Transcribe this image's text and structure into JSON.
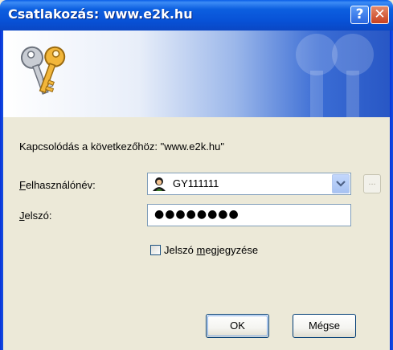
{
  "window": {
    "title": "Csatlakozás: www.e2k.hu",
    "help_label": "?",
    "close_label": "✕"
  },
  "dialog": {
    "connect_text": "Kapcsolódás a következőhöz: \"www.e2k.hu\"",
    "username_label_hotkey": "F",
    "username_label_rest": "elhasználónév:",
    "username_value": "GY111111",
    "password_label_hotkey": "J",
    "password_label_rest": "elszó:",
    "password_mask": "●●●●●●●●",
    "browse_label": "...",
    "remember_label_before": "Jelszó ",
    "remember_label_hotkey": "m",
    "remember_label_after": "egjegyzése",
    "remember_checked": false,
    "ok_label": "OK",
    "cancel_label": "Mégse"
  },
  "colors": {
    "title_bar": "#0851d6",
    "dialog_bg": "#ece9d8",
    "input_border": "#7f9db9"
  },
  "icons": {
    "banner": "keys-icon",
    "user": "user-icon",
    "dropdown": "chevron-down-icon"
  }
}
